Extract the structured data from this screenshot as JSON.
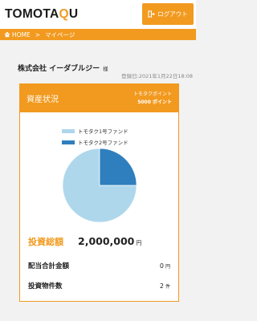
{
  "header": {
    "logo_left": "TOMOTA",
    "logo_accent": "Q",
    "logo_right": "U",
    "logout_label": "ログアウト"
  },
  "breadcrumb": {
    "home": "HOME",
    "separator": ">",
    "current": "マイページ"
  },
  "account": {
    "company_name": "株式会社 イーダブルジー",
    "honorific": "様",
    "login_date": "登録日:2021年1月22日18:08"
  },
  "assets": {
    "title": "資産状況",
    "points_label": "トモタクポイント",
    "points_value": "5000 ポイント",
    "accent_color": "#f29a1f",
    "total_label": "投資総額",
    "total_value": "2,000,000",
    "total_unit": "円",
    "dividend_label": "配当合計金額",
    "dividend_value": "0",
    "dividend_unit": "円",
    "count_label": "投資物件数",
    "count_value": "2",
    "count_unit": "件"
  },
  "chart_data": {
    "type": "pie",
    "series": [
      {
        "name": "トモタク1号ファンド",
        "value": 75,
        "color": "#aed7ec"
      },
      {
        "name": "トモタク2号ファンド",
        "value": 25,
        "color": "#2f7fbf"
      }
    ],
    "legend_position": "top"
  }
}
